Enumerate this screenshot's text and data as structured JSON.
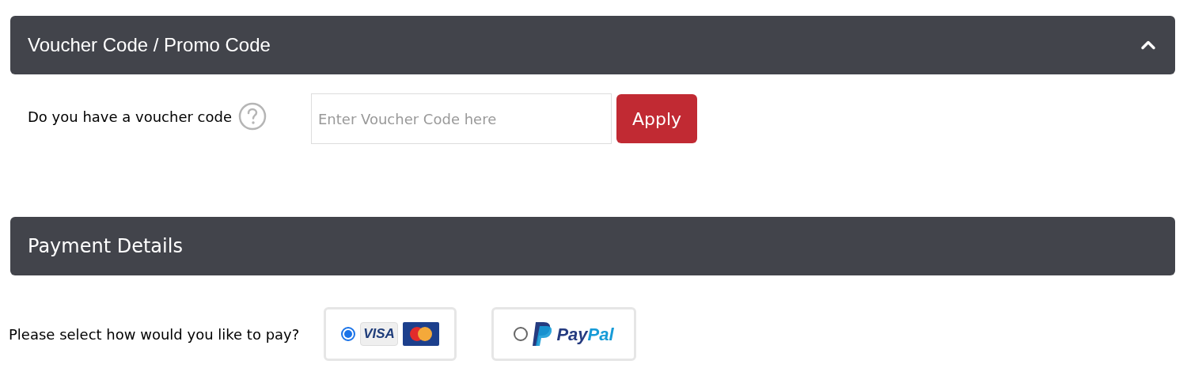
{
  "voucher_section": {
    "title": "Voucher Code / Promo Code",
    "expanded": true,
    "label": "Do you have a voucher code",
    "field": {
      "placeholder": "Enter Voucher Code here"
    },
    "button": "Apply"
  },
  "payment_section": {
    "title": "Payment Details",
    "prompt": "Please select how would you like to pay?",
    "options": [
      {
        "kind": "card",
        "selected": true,
        "logos": [
          "VISA"
        ]
      },
      {
        "kind": "paypal",
        "selected": false,
        "logos": [
          "Pay",
          "Pal"
        ]
      }
    ]
  }
}
